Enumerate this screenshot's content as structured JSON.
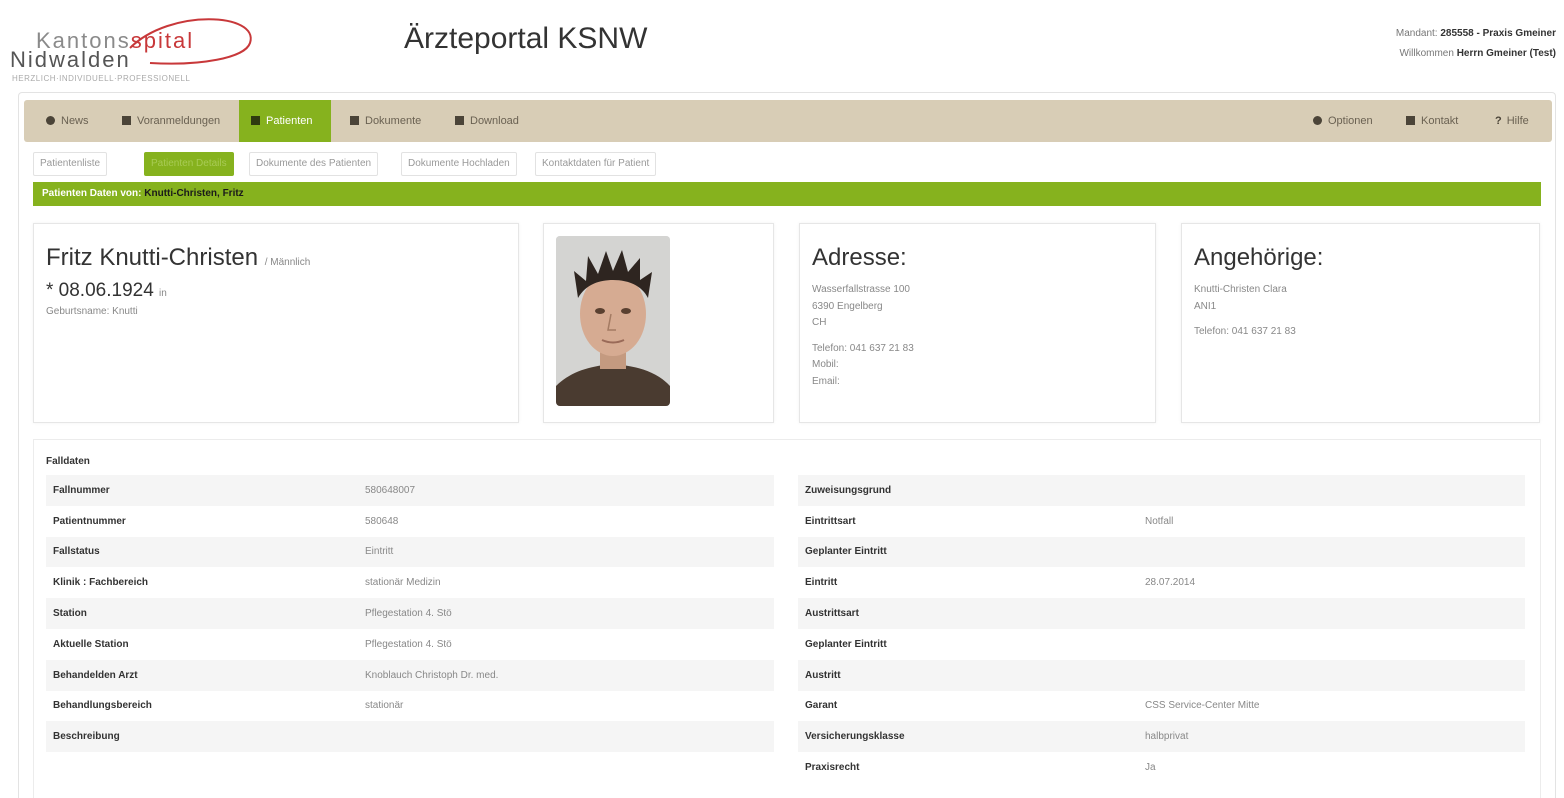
{
  "header": {
    "logo_line1a": "Kantons",
    "logo_line1b": "spital",
    "logo_line2": "Nidwalden",
    "logo_tagline": "HERZLICH·INDIVIDUELL·PROFESSIONELL",
    "app_title": "Ärzteportal KSNW",
    "mandant_label": "Mandant:",
    "mandant_value": "285558 - Praxis Gmeiner",
    "welcome_label": "Willkommen",
    "welcome_value": "Herrn Gmeiner (Test)"
  },
  "nav": {
    "items": [
      {
        "label": "News",
        "icon": "globe-icon"
      },
      {
        "label": "Voranmeldungen",
        "icon": "form-icon"
      },
      {
        "label": "Patienten",
        "icon": "user-icon",
        "active": true
      },
      {
        "label": "Dokumente",
        "icon": "document-icon"
      },
      {
        "label": "Download",
        "icon": "download-icon"
      }
    ],
    "right_items": [
      {
        "label": "Optionen",
        "icon": "gear-icon"
      },
      {
        "label": "Kontakt",
        "icon": "envelope-icon"
      },
      {
        "label": "Hilfe",
        "icon": "question-icon"
      }
    ]
  },
  "subtabs": [
    "Patientenliste",
    "Patienten Details",
    "Dokumente des Patienten",
    "Dokumente Hochladen",
    "Kontaktdaten für Patient"
  ],
  "patient_bar": {
    "label": "Patienten Daten von:",
    "name": "Knutti-Christen, Fritz"
  },
  "patient": {
    "name": "Fritz Knutti-Christen",
    "gender": "/ Männlich",
    "birth": "* 08.06.1924",
    "birth_suffix": "in",
    "birthname": "Geburtsname: Knutti"
  },
  "address": {
    "title": "Adresse:",
    "street": "Wasserfallstrasse 100",
    "city": "6390 Engelberg",
    "country": "CH",
    "phone": "Telefon: 041 637 21 83",
    "mobile": "Mobil:",
    "email": "Email:"
  },
  "relatives": {
    "title": "Angehörige:",
    "name": "Knutti-Christen Clara",
    "relation": "ANI1",
    "phone": "Telefon: 041 637 21 83"
  },
  "falldaten": {
    "title": "Falldaten",
    "left": [
      {
        "key": "Fallnummer",
        "value": "580648007"
      },
      {
        "key": "Patientnummer",
        "value": "580648"
      },
      {
        "key": "Fallstatus",
        "value": "Eintritt"
      },
      {
        "key": "Klinik : Fachbereich",
        "value": "stationär Medizin"
      },
      {
        "key": "Station",
        "value": "Pflegestation 4. Stö"
      },
      {
        "key": "Aktuelle Station",
        "value": "Pflegestation 4. Stö"
      },
      {
        "key": "Behandelden Arzt",
        "value": "Knoblauch Christoph Dr. med."
      },
      {
        "key": "Behandlungsbereich",
        "value": "stationär"
      },
      {
        "key": "Beschreibung",
        "value": ""
      }
    ],
    "right": [
      {
        "key": "Zuweisungsgrund",
        "value": ""
      },
      {
        "key": "Eintrittsart",
        "value": "Notfall"
      },
      {
        "key": "Geplanter Eintritt",
        "value": ""
      },
      {
        "key": "Eintritt",
        "value": "28.07.2014"
      },
      {
        "key": "Austrittsart",
        "value": ""
      },
      {
        "key": "Geplanter Eintritt",
        "value": ""
      },
      {
        "key": "Austritt",
        "value": ""
      },
      {
        "key": "Garant",
        "value": "CSS Service-Center Mitte"
      },
      {
        "key": "Versicherungsklasse",
        "value": "halbprivat"
      },
      {
        "key": "Praxisrecht",
        "value": "Ja"
      }
    ]
  }
}
